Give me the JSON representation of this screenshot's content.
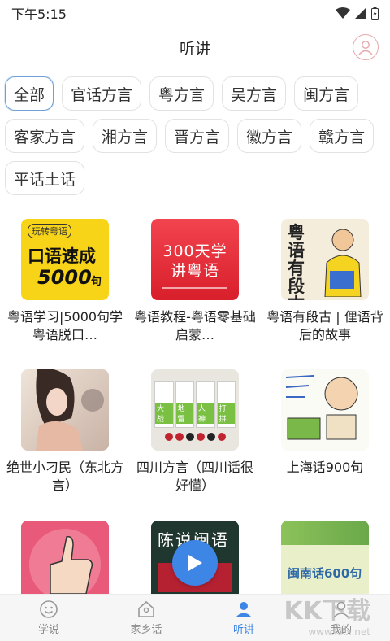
{
  "status": {
    "time": "下午5:15"
  },
  "header": {
    "title": "听讲"
  },
  "chips": [
    {
      "label": "全部",
      "active": true
    },
    {
      "label": "官话方言"
    },
    {
      "label": "粤方言"
    },
    {
      "label": "吴方言"
    },
    {
      "label": "闽方言"
    },
    {
      "label": "客家方言"
    },
    {
      "label": "湘方言"
    },
    {
      "label": "晋方言"
    },
    {
      "label": "徽方言"
    },
    {
      "label": "赣方言"
    },
    {
      "label": "平话土话"
    }
  ],
  "cards": [
    {
      "caption": "粤语学习|5000句学粤语脱口…",
      "thumb_top": "玩转粤语",
      "thumb_main": "口语速成",
      "thumb_num": "5000",
      "thumb_unit": "句"
    },
    {
      "caption": "粤语教程-粤语零基础启蒙…",
      "thumb_main": "300天学讲粤语"
    },
    {
      "caption": "粤语有段古 | 俚语背后的故事",
      "thumb_main": "粤语有段古"
    },
    {
      "caption": "绝世小刁民（东北方言）"
    },
    {
      "caption": "四川方言（四川话很好懂）",
      "thumb_tiles": [
        "大战",
        "地雷",
        "人神",
        "打拼"
      ]
    },
    {
      "caption": "上海话900句"
    },
    {
      "caption": ""
    },
    {
      "caption": "",
      "thumb_main": "陈说闽语"
    },
    {
      "caption": "",
      "thumb_main": "闽南话600句"
    }
  ],
  "tabs": [
    {
      "label": "学说"
    },
    {
      "label": "家乡话"
    },
    {
      "label": "听讲",
      "active": true
    },
    {
      "label": "我的"
    }
  ],
  "watermark": {
    "text": "KK下载",
    "url": "www.kkx.net"
  },
  "colors": {
    "accent": "#3e86e6",
    "chip_active_border": "#6ea1d8"
  }
}
